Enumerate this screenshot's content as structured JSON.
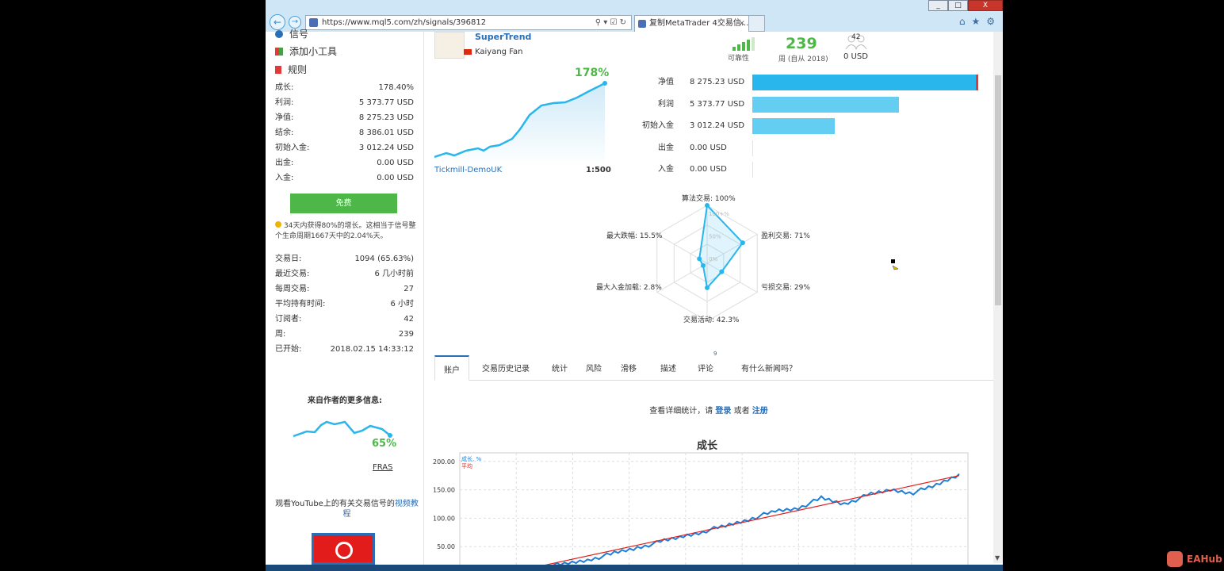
{
  "browser": {
    "url": "https://www.mql5.com/zh/signals/396812",
    "tab_title": "复制MetaTrader 4交易信...",
    "window_controls": [
      "_",
      "□",
      "X"
    ]
  },
  "sidebar": {
    "menu": [
      {
        "label": "信号",
        "icon": "signal-icon"
      },
      {
        "label": "添加小工具",
        "icon": "widget-icon"
      },
      {
        "label": "规则",
        "icon": "bookmark-icon"
      }
    ],
    "account_stats": [
      {
        "label": "成长:",
        "value": "178.40%"
      },
      {
        "label": "利润:",
        "value": "5 373.77 USD"
      },
      {
        "label": "净值:",
        "value": "8 275.23 USD"
      },
      {
        "label": "结余:",
        "value": "8 386.01 USD"
      },
      {
        "label": "初始入金:",
        "value": "3 012.24 USD"
      },
      {
        "label": "出金:",
        "value": "0.00 USD"
      },
      {
        "label": "入金:",
        "value": "0.00 USD"
      }
    ],
    "free_button": "免费",
    "note": "34天内获得80%的增长。这相当于信号整个生命周期1667天中的2.04%天。",
    "trade_stats": [
      {
        "label": "交易日:",
        "value": "1094 (65.63%)"
      },
      {
        "label": "最近交易:",
        "value": "6 几小时前"
      },
      {
        "label": "每周交易:",
        "value": "27"
      },
      {
        "label": "平均持有时间:",
        "value": "6 小时"
      },
      {
        "label": "订阅者:",
        "value": "42"
      },
      {
        "label": "周:",
        "value": "239"
      },
      {
        "label": "已开始:",
        "value": "2018.02.15 14:33:12"
      }
    ],
    "author_more_title": "来自作者的更多信息:",
    "author_signal_pct": "65%",
    "author_signal_name": "FRAS",
    "youtube_text": "观看YouTube上的有关交易信号的",
    "youtube_link": "视频教程"
  },
  "signal": {
    "name": "SuperTrend",
    "author": "Kaiyang Fan",
    "reliability_label": "可靠性",
    "weeks_value": "239",
    "weeks_label": "周 (自从 2018)",
    "subscribers_badge": "42",
    "subscribers_value": "0 USD",
    "growth_pct": "178%",
    "broker": "Tickmill-DemoUK",
    "leverage": "1:500"
  },
  "balance_bars": [
    {
      "label": "净值",
      "value": "8 275.23 USD",
      "amount": 8275.23,
      "color": "#29b6ec"
    },
    {
      "label": "利润",
      "value": "5 373.77 USD",
      "amount": 5373.77,
      "color": "#63cdf2"
    },
    {
      "label": "初始入金",
      "value": "3 012.24 USD",
      "amount": 3012.24,
      "color": "#63cdf2"
    },
    {
      "label": "出金",
      "value": "0.00 USD",
      "amount": 0,
      "color": "#63cdf2"
    },
    {
      "label": "入金",
      "value": "0.00 USD",
      "amount": 0,
      "color": "#63cdf2"
    }
  ],
  "radar": {
    "axes": [
      {
        "label": "算法交易: 100%",
        "value": 100
      },
      {
        "label": "盈利交易: 71%",
        "value": 71
      },
      {
        "label": "亏损交易: 29%",
        "value": 29
      },
      {
        "label": "交易活动: 42.3%",
        "value": 42.3
      },
      {
        "label": "最大入金加载: 2.8%",
        "value": 2.8
      },
      {
        "label": "最大跌幅: 15.5%",
        "value": 15.5
      }
    ],
    "ring_labels": [
      "100+%",
      "50%",
      "0%"
    ]
  },
  "tabs": [
    "账户",
    "交易历史记录",
    "统计",
    "风险",
    "滑移",
    "描述",
    "评论",
    "有什么新闻吗？"
  ],
  "tab_badge": "9",
  "login_msg": {
    "prefix": "查看详细统计，请",
    "login": "登录",
    "or": "或者",
    "register": "注册"
  },
  "chart_data": {
    "type": "line",
    "title": "成长",
    "ylim": [
      0,
      200
    ],
    "yticks": [
      "200.00",
      "150.00",
      "100.00",
      "50.00"
    ],
    "series": [
      {
        "name": "成长, %",
        "color": "#1f7fd6",
        "x": [
          0,
          5,
          10,
          15,
          20,
          25,
          30,
          35,
          40,
          45,
          50,
          55,
          60,
          65,
          70,
          75,
          80,
          85,
          90,
          95,
          100
        ],
        "y": [
          2,
          8,
          15,
          20,
          28,
          38,
          48,
          58,
          68,
          78,
          88,
          100,
          112,
          118,
          135,
          125,
          140,
          150,
          145,
          158,
          178
        ]
      },
      {
        "name": "平均",
        "color": "#e0201e",
        "x": [
          0,
          100
        ],
        "y": [
          0,
          175
        ]
      }
    ]
  },
  "watermark": "EAHub"
}
